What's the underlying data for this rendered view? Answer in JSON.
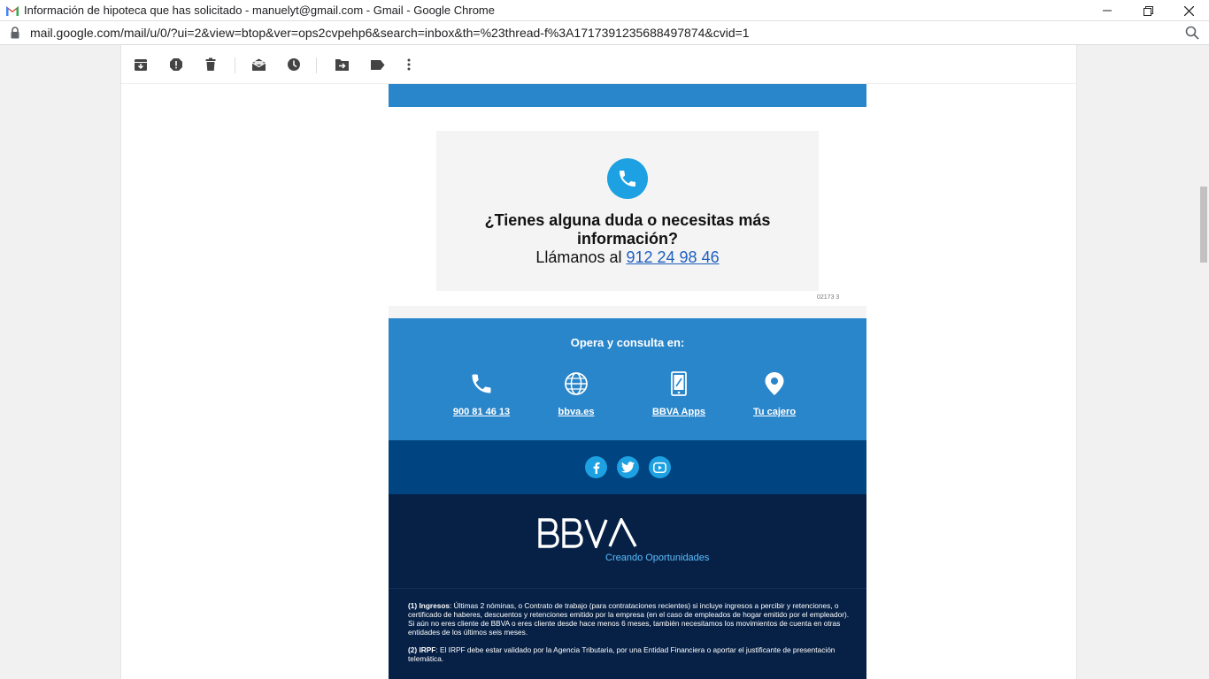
{
  "window": {
    "title": "Información de hipoteca que has solicitado - manuelyt@gmail.com - Gmail - Google Chrome",
    "url": "mail.google.com/mail/u/0/?ui=2&view=btop&ver=ops2cvpehp6&search=inbox&th=%23thread-f%3A1717391235688497874&cvid=1"
  },
  "toolbar": {
    "icons": [
      "archive-icon",
      "report-spam-icon",
      "delete-icon",
      "mark-unread-icon",
      "snooze-icon",
      "move-to-icon",
      "label-icon",
      "more-icon"
    ]
  },
  "contact": {
    "question": "¿Tienes alguna duda o necesitas más información?",
    "call_prefix": "Llámanos al",
    "phone": "912 24 98 46",
    "ref_code": "02173 3"
  },
  "opera": {
    "title": "Opera y consulta en:",
    "items": [
      {
        "label": "900 81 46 13",
        "icon": "phone-icon"
      },
      {
        "label": "bbva.es",
        "icon": "globe-icon"
      },
      {
        "label": "BBVA Apps",
        "icon": "mobile-icon"
      },
      {
        "label": "Tu cajero",
        "icon": "location-pin-icon"
      }
    ]
  },
  "social": {
    "icons": [
      "facebook-icon",
      "twitter-icon",
      "youtube-icon"
    ]
  },
  "brand": {
    "logo": "BBVA",
    "tagline": "Creando Oportunidades"
  },
  "legal": {
    "p1_label": "(1) Ingresos",
    "p1_text": ": Últimas 2 nóminas, o Contrato de trabajo (para contrataciones recientes) si incluye ingresos a percibir y retenciones, o certificado de haberes, descuentos y retenciones emitido por la empresa (en el caso de empleados de hogar emitido por el empleador). Si aún no eres cliente de BBVA o eres cliente desde hace menos 6 meses, también necesitamos los movimientos de cuenta en otras entidades de los últimos seis meses.",
    "p2_label": "(2) IRPF",
    "p2_text": ": El IRPF debe estar validado por la Agencia Tributaria, por una Entidad Financiera o aportar el justificante de presentación telemática."
  },
  "colors": {
    "bbva_blue": "#2a86ca",
    "bbva_navy": "#004481",
    "bbva_dark": "#072146",
    "accent_cyan": "#1da1e2"
  }
}
